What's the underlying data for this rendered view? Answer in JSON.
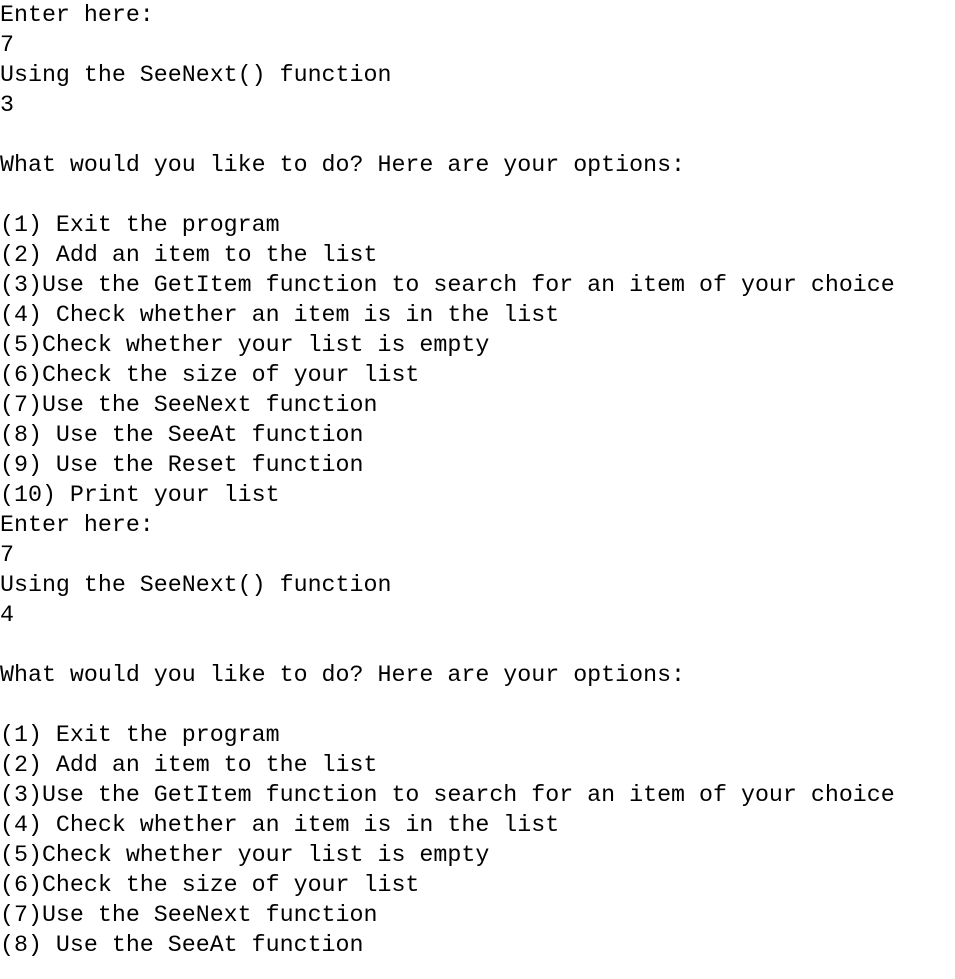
{
  "console": {
    "lines": [
      "Enter here:",
      "7",
      "Using the SeeNext() function",
      "3",
      "",
      "What would you like to do? Here are your options:",
      "",
      "(1) Exit the program",
      "(2) Add an item to the list",
      "(3)Use the GetItem function to search for an item of your choice",
      "(4) Check whether an item is in the list",
      "(5)Check whether your list is empty",
      "(6)Check the size of your list",
      "(7)Use the SeeNext function",
      "(8) Use the SeeAt function",
      "(9) Use the Reset function",
      "(10) Print your list",
      "Enter here:",
      "7",
      "Using the SeeNext() function",
      "4",
      "",
      "What would you like to do? Here are your options:",
      "",
      "(1) Exit the program",
      "(2) Add an item to the list",
      "(3)Use the GetItem function to search for an item of your choice",
      "(4) Check whether an item is in the list",
      "(5)Check whether your list is empty",
      "(6)Check the size of your list",
      "(7)Use the SeeNext function",
      "(8) Use the SeeAt function"
    ]
  }
}
